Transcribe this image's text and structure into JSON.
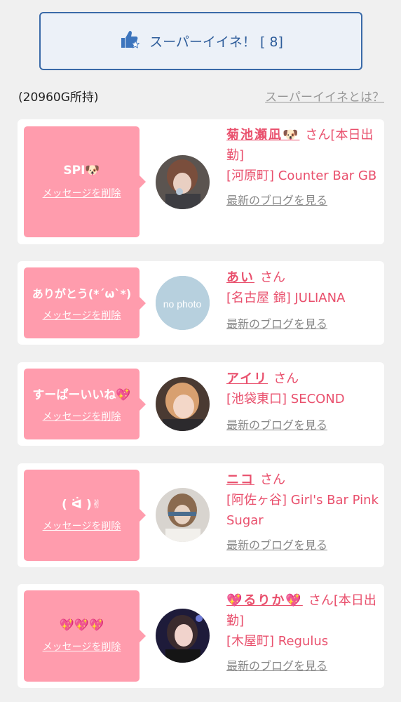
{
  "super_button": {
    "icon": "thumbs-up-star-icon",
    "label": "スーパーイイネ！ [ 8]"
  },
  "gold_status": "(20960G所持)",
  "what_is_link": "スーパーイイネとは？",
  "colors": {
    "accent_pink": "#ff9cad",
    "name_pink": "#e9506d",
    "button_blue": "#2d5c9a"
  },
  "likes": [
    {
      "message": "SPI🐶",
      "delete_label": "メッセージを削除",
      "name": "菊池瀬凪🐶",
      "honorific": "さん[本日出勤]",
      "shop": "[河原町] Counter Bar GB",
      "blog_link": "最新のブログを見る"
    },
    {
      "message": "ありがとう(*´ω`*)",
      "delete_label": "メッセージを削除",
      "name": "あい",
      "honorific": "さん",
      "shop": "[名古屋 錦] JULIANA",
      "blog_link": "最新のブログを見る",
      "avatar_text": "no photo"
    },
    {
      "message": "すーぱーいいね💖",
      "delete_label": "メッセージを削除",
      "name": "アイリ",
      "honorific": "さん",
      "shop": "[池袋東口] SECOND",
      "blog_link": "最新のブログを見る"
    },
    {
      "message": "( ᐛ )✌",
      "delete_label": "メッセージを削除",
      "name": "ニコ",
      "honorific": "さん",
      "shop": "[阿佐ヶ谷] Girl's Bar Pink Sugar",
      "blog_link": "最新のブログを見る"
    },
    {
      "message": "💖💖💖",
      "delete_label": "メッセージを削除",
      "name": "💖るりか💖",
      "honorific": "さん[本日出勤]",
      "shop": "[木屋町] Regulus",
      "blog_link": "最新のブログを見る"
    }
  ]
}
